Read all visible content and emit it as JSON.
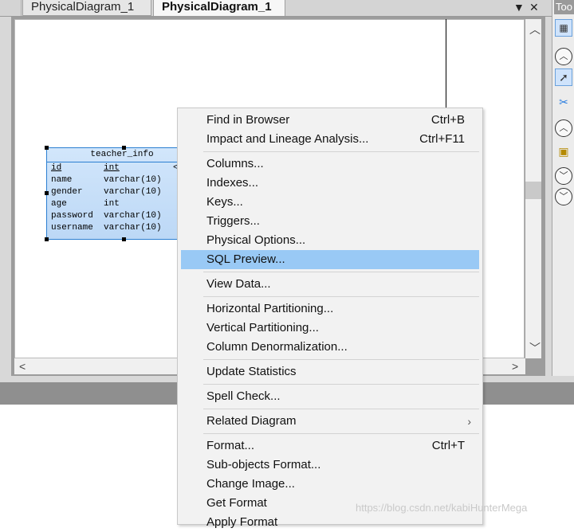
{
  "tabs": {
    "inactive": "PhysicalDiagram_1",
    "active": "PhysicalDiagram_1",
    "dropdown_icon": "▼",
    "close_icon": "✕"
  },
  "toolbox": {
    "title": "Too"
  },
  "entity": {
    "name": "teacher_info",
    "cut_col": "<",
    "columns": [
      {
        "name": "id",
        "type": "int",
        "key": true
      },
      {
        "name": "name",
        "type": "varchar(10)",
        "key": false
      },
      {
        "name": "gender",
        "type": "varchar(10)",
        "key": false
      },
      {
        "name": "age",
        "type": "int",
        "key": false
      },
      {
        "name": "password",
        "type": "varchar(10)",
        "key": false
      },
      {
        "name": "username",
        "type": "varchar(10)",
        "key": false
      }
    ]
  },
  "menu": {
    "find_in_browser": {
      "label": "Find in Browser",
      "shortcut": "Ctrl+B"
    },
    "impact_lineage": {
      "label": "Impact and Lineage Analysis...",
      "shortcut": "Ctrl+F11"
    },
    "columns": "Columns...",
    "indexes": "Indexes...",
    "keys": "Keys...",
    "triggers": "Triggers...",
    "physical_options": "Physical Options...",
    "sql_preview": "SQL Preview...",
    "view_data": "View Data...",
    "horizontal_partitioning": "Horizontal Partitioning...",
    "vertical_partitioning": "Vertical Partitioning...",
    "column_denormalization": "Column Denormalization...",
    "update_statistics": "Update Statistics",
    "spell_check": "Spell Check...",
    "related_diagram": "Related Diagram",
    "format": {
      "label": "Format...",
      "shortcut": "Ctrl+T"
    },
    "subobjects_format": "Sub-objects Format...",
    "change_image": "Change Image...",
    "get_format": "Get Format",
    "apply_format": "Apply Format",
    "submenu_arrow": "›",
    "highlighted": "sql_preview"
  },
  "watermark": "https://blog.csdn.net/kabiHunterMega",
  "colors": {
    "highlight": "#99c9f5",
    "entity_border": "#2b7fd1",
    "entity_fill": "#c8dff8"
  }
}
